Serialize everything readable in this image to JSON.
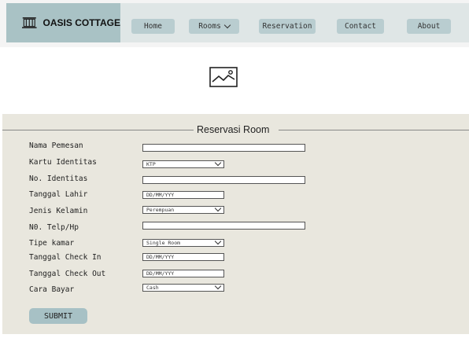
{
  "brand": {
    "name": "OASIS COTTAGE",
    "icon": "building-icon"
  },
  "nav": {
    "items": [
      {
        "label": "Home"
      },
      {
        "label": "Rooms"
      },
      {
        "label": "Reservation"
      },
      {
        "label": "Contact"
      },
      {
        "label": "About"
      }
    ]
  },
  "hero": {
    "icon": "image-placeholder-icon"
  },
  "form": {
    "title": "Reservasi Room",
    "fields": [
      {
        "label": "Nama Pemesan",
        "value": ""
      },
      {
        "label": "Kartu Identitas",
        "value": "KTP"
      },
      {
        "label": "No. Identitas",
        "value": ""
      },
      {
        "label": "Tanggal Lahir",
        "placeholder": "DD/MM/YYY"
      },
      {
        "label": "Jenis Kelamin",
        "value": "Perempuan"
      },
      {
        "label": "N0. Telp/Hp",
        "value": ""
      },
      {
        "label": "Tipe kamar",
        "value": "Single Room"
      },
      {
        "label": "Tanggal Check In",
        "placeholder": "DD/MM/YYY"
      },
      {
        "label": "Tanggal Check Out",
        "placeholder": "DD/MM/YYY"
      },
      {
        "label": "Cara Bayar",
        "value": "Cash"
      }
    ],
    "submit_label": "SUBMIT"
  },
  "colors": {
    "brand_bg": "#a9c2c5",
    "nav_bg": "#dfe6e6",
    "nav_button": "#b9cdd0",
    "panel_bg": "#e9e7de",
    "submit_bg": "#a7c1c5"
  }
}
